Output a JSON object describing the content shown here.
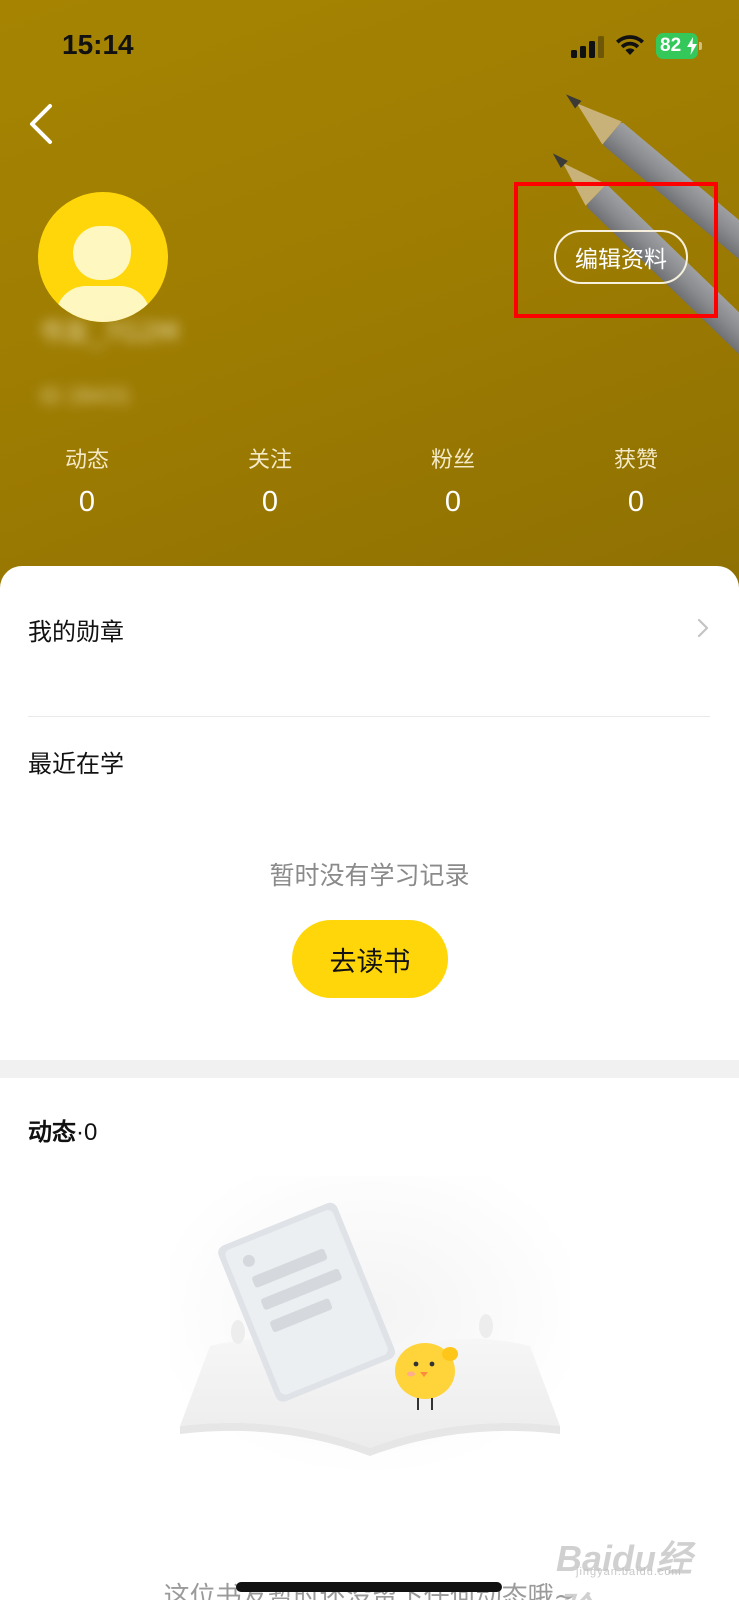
{
  "status_bar": {
    "time": "15:14",
    "battery_percent": "82",
    "battery_charging": true,
    "icons": [
      "signal-icon",
      "wifi-icon",
      "battery-icon"
    ]
  },
  "header": {
    "background_color": "#9c7b02",
    "back_icon": "chevron-left-icon",
    "edit_label": "编辑资料",
    "highlight_color": "#ff0000"
  },
  "profile": {
    "avatar_icon": "default-avatar-icon",
    "avatar_color": "#ffd60a"
  },
  "stats": [
    {
      "label": "动态",
      "value": "0"
    },
    {
      "label": "关注",
      "value": "0"
    },
    {
      "label": "粉丝",
      "value": "0"
    },
    {
      "label": "获赞",
      "value": "0"
    }
  ],
  "badges": {
    "label": "我的勋章",
    "icon": "chevron-right-icon"
  },
  "recent": {
    "title": "最近在学",
    "empty_text": "暂时没有学习记录",
    "button_label": "去读书",
    "button_color": "#ffd60a"
  },
  "feed": {
    "title": "动态",
    "count": "·0",
    "illustration": "empty-book-chick-illustration",
    "empty_text": "这位书友暂时还没留下任何动态哦~"
  },
  "watermark": {
    "text": "Baidu经验",
    "sub": "jingyan.baidu.com"
  }
}
